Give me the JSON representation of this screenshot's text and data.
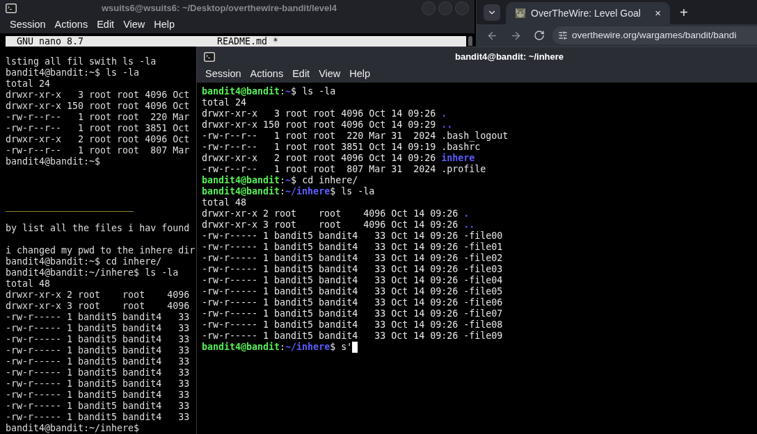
{
  "back_terminal": {
    "title": "wsuits6@wsuits6: ~/Desktop/overthewire-bandit/level4",
    "menu": [
      "Session",
      "Actions",
      "Edit",
      "View",
      "Help"
    ],
    "nano_header": {
      "app": "GNU nano 8.7",
      "file": "README.md *"
    },
    "lines": [
      {
        "kind": "text",
        "text": "lsting all fil swith ls -la"
      },
      {
        "kind": "text",
        "text": "bandit4@bandit:~$ ls -la"
      },
      {
        "kind": "text",
        "text": "total 24"
      },
      {
        "kind": "text",
        "text": "drwxr-xr-x   3 root root 4096 Oct"
      },
      {
        "kind": "text",
        "text": "drwxr-xr-x 150 root root 4096 Oct"
      },
      {
        "kind": "text",
        "text": "-rw-r--r--   1 root root  220 Mar"
      },
      {
        "kind": "text",
        "text": "-rw-r--r--   1 root root 3851 Oct"
      },
      {
        "kind": "text",
        "text": "drwxr-xr-x   2 root root 4096 Oct"
      },
      {
        "kind": "text",
        "text": "-rw-r--r--   1 root root  807 Mar"
      },
      {
        "kind": "text",
        "text": "bandit4@bandit:~$"
      },
      {
        "kind": "blank"
      },
      {
        "kind": "blank"
      },
      {
        "kind": "blank"
      },
      {
        "kind": "highlight",
        "text": "_______________________"
      },
      {
        "kind": "blank"
      },
      {
        "kind": "text",
        "text": "by list all the files i hav found"
      },
      {
        "kind": "blank"
      },
      {
        "kind": "text",
        "text": "i changed my pwd to the inhere dir"
      },
      {
        "kind": "text",
        "text": "bandit4@bandit:~$ cd inhere/"
      },
      {
        "kind": "text",
        "text": "bandit4@bandit:~/inhere$ ls -la"
      },
      {
        "kind": "text",
        "text": "total 48"
      },
      {
        "kind": "text",
        "text": "drwxr-xr-x 2 root    root    4096"
      },
      {
        "kind": "text",
        "text": "drwxr-xr-x 3 root    root    4096"
      },
      {
        "kind": "text",
        "text": "-rw-r----- 1 bandit5 bandit4   33"
      },
      {
        "kind": "text",
        "text": "-rw-r----- 1 bandit5 bandit4   33"
      },
      {
        "kind": "text",
        "text": "-rw-r----- 1 bandit5 bandit4   33"
      },
      {
        "kind": "text",
        "text": "-rw-r----- 1 bandit5 bandit4   33"
      },
      {
        "kind": "text",
        "text": "-rw-r----- 1 bandit5 bandit4   33"
      },
      {
        "kind": "text",
        "text": "-rw-r----- 1 bandit5 bandit4   33"
      },
      {
        "kind": "text",
        "text": "-rw-r----- 1 bandit5 bandit4   33"
      },
      {
        "kind": "text",
        "text": "-rw-r----- 1 bandit5 bandit4   33"
      },
      {
        "kind": "text",
        "text": "-rw-r----- 1 bandit5 bandit4   33"
      },
      {
        "kind": "text",
        "text": "-rw-r----- 1 bandit5 bandit4   33"
      },
      {
        "kind": "text",
        "text": "bandit4@bandit:~/inhere$"
      }
    ]
  },
  "browser": {
    "tabs": [
      {
        "title": "OverTheWire: Level Goal",
        "close": "×",
        "selected": true
      }
    ],
    "new_tab": "+",
    "url": "overthewire.org/wargames/bandit/bandi"
  },
  "front_terminal": {
    "title": "bandit4@bandit: ~/inhere",
    "menu": [
      "Session",
      "Actions",
      "Edit",
      "View",
      "Help"
    ],
    "lines": [
      {
        "kind": "prompt",
        "user": "bandit4@bandit",
        "colon": ":",
        "path": "~",
        "sign": "$",
        "command": "ls -la",
        "cursor": false
      },
      {
        "kind": "output",
        "text": "total 24"
      },
      {
        "kind": "output",
        "text": "drwxr-xr-x   3 root root 4096 Oct 14 09:26",
        "name": ".",
        "is_dir": true
      },
      {
        "kind": "output",
        "text": "drwxr-xr-x 150 root root 4096 Oct 14 09:29",
        "name": "..",
        "is_dir": true
      },
      {
        "kind": "output",
        "text": "-rw-r--r--   1 root root  220 Mar 31  2024",
        "name": ".bash_logout",
        "is_dir": false
      },
      {
        "kind": "output",
        "text": "-rw-r--r--   1 root root 3851 Oct 14 09:19",
        "name": ".bashrc",
        "is_dir": false
      },
      {
        "kind": "output",
        "text": "drwxr-xr-x   2 root root 4096 Oct 14 09:26",
        "name": "inhere",
        "is_dir": true
      },
      {
        "kind": "output",
        "text": "-rw-r--r--   1 root root  807 Mar 31  2024",
        "name": ".profile",
        "is_dir": false
      },
      {
        "kind": "prompt",
        "user": "bandit4@bandit",
        "colon": ":",
        "path": "~",
        "sign": "$",
        "command": "cd inhere/",
        "cursor": false
      },
      {
        "kind": "prompt",
        "user": "bandit4@bandit",
        "colon": ":",
        "path": "~/inhere",
        "sign": "$",
        "command": "ls -la",
        "cursor": false
      },
      {
        "kind": "output",
        "text": "total 48"
      },
      {
        "kind": "output",
        "text": "drwxr-xr-x 2 root    root    4096 Oct 14 09:26",
        "name": ".",
        "is_dir": true
      },
      {
        "kind": "output",
        "text": "drwxr-xr-x 3 root    root    4096 Oct 14 09:26",
        "name": "..",
        "is_dir": true
      },
      {
        "kind": "output",
        "text": "-rw-r----- 1 bandit5 bandit4   33 Oct 14 09:26",
        "name": "-file00",
        "is_dir": false
      },
      {
        "kind": "output",
        "text": "-rw-r----- 1 bandit5 bandit4   33 Oct 14 09:26",
        "name": "-file01",
        "is_dir": false
      },
      {
        "kind": "output",
        "text": "-rw-r----- 1 bandit5 bandit4   33 Oct 14 09:26",
        "name": "-file02",
        "is_dir": false
      },
      {
        "kind": "output",
        "text": "-rw-r----- 1 bandit5 bandit4   33 Oct 14 09:26",
        "name": "-file03",
        "is_dir": false
      },
      {
        "kind": "output",
        "text": "-rw-r----- 1 bandit5 bandit4   33 Oct 14 09:26",
        "name": "-file04",
        "is_dir": false
      },
      {
        "kind": "output",
        "text": "-rw-r----- 1 bandit5 bandit4   33 Oct 14 09:26",
        "name": "-file05",
        "is_dir": false
      },
      {
        "kind": "output",
        "text": "-rw-r----- 1 bandit5 bandit4   33 Oct 14 09:26",
        "name": "-file06",
        "is_dir": false
      },
      {
        "kind": "output",
        "text": "-rw-r----- 1 bandit5 bandit4   33 Oct 14 09:26",
        "name": "-file07",
        "is_dir": false
      },
      {
        "kind": "output",
        "text": "-rw-r----- 1 bandit5 bandit4   33 Oct 14 09:26",
        "name": "-file08",
        "is_dir": false
      },
      {
        "kind": "output",
        "text": "-rw-r----- 1 bandit5 bandit4   33 Oct 14 09:26",
        "name": "-file09",
        "is_dir": false
      },
      {
        "kind": "prompt",
        "user": "bandit4@bandit",
        "colon": ":",
        "path": "~/inhere",
        "sign": "$",
        "command": "s'",
        "cursor": true
      }
    ]
  }
}
